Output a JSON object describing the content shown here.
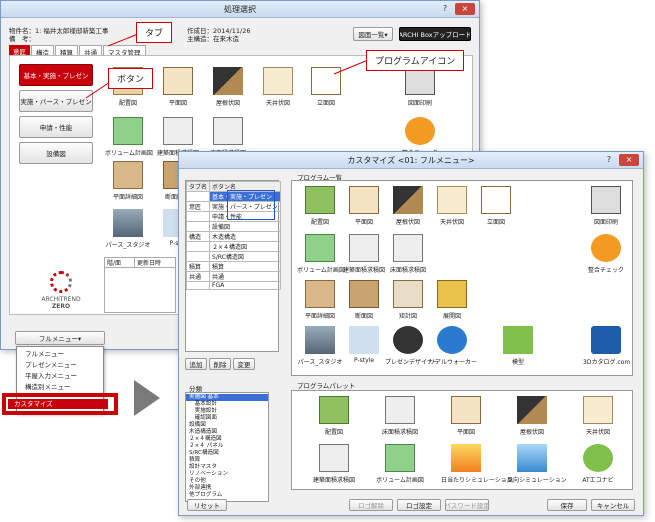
{
  "back_window": {
    "title": "処理選択",
    "help_btn": "?",
    "close_btn": "×",
    "property_name": "物件名：1: 福井太郎様邸新築工事",
    "property_note": "備　考：",
    "created_label": "作成日：2014/11/26",
    "structure_label": "主構造：在来木造",
    "list_button": "図面一覧▾",
    "upload_button": "ARCHI Boxアップロード",
    "tabs": [
      "意匠",
      "構造",
      "積算",
      "共通",
      "マスタ管理"
    ],
    "side_buttons": [
      "基本・実施・プレゼン",
      "実施・パース・プレゼン",
      "申請・性能",
      "設備図"
    ],
    "icons_row1": [
      "配置図",
      "平面図",
      "屋根伏図",
      "天井伏図",
      "立面図",
      "図面印刷"
    ],
    "icons_row2": [
      "ボリューム計画図",
      "建築面積求積図",
      "床面積求積図",
      "整合チェック"
    ],
    "icons_row3": [
      "平面詳細図",
      "断面図"
    ],
    "icons_row4": [
      "パース_スタジオ",
      "P-s"
    ],
    "table_headers": [
      "階/面",
      "更新日時"
    ],
    "logo_line1": "ARCHITREND",
    "logo_line2": "ZERO",
    "menu_button": "フルメニュー▾"
  },
  "dropdown": {
    "items": [
      "フルメニュー",
      "プレゼンメニュー",
      "平屋入力メニュー",
      "構造別メニュー"
    ],
    "selected": "カスタマイズ"
  },
  "callouts": {
    "tab": "タブ",
    "button": "ボタン",
    "program_icon": "プログラムアイコン"
  },
  "custom_window": {
    "title": "カスタマイズ <01: フルメニュー>",
    "help_btn": "?",
    "close_btn": "×",
    "table_headers": [
      "タブ名",
      "ボタン名"
    ],
    "table_rows": [
      [
        "",
        "基本・実施・プレゼン"
      ],
      [
        "意匠",
        "実施・パース・プレゼン"
      ],
      [
        "",
        "申請・性能"
      ],
      [
        "",
        "設備図"
      ],
      [
        "構造",
        "木造構造"
      ],
      [
        "",
        "２×４構造図"
      ],
      [
        "",
        "S/RC構造図"
      ],
      [
        "積算",
        "積算"
      ],
      [
        "共通",
        "共通"
      ],
      [
        "",
        "FGA"
      ]
    ],
    "table_buttons": [
      "追加",
      "削除",
      "変更"
    ],
    "category_label": "分類",
    "categories": [
      "実施図 基本",
      "　基本設計",
      "　実施設計",
      "　確認図面",
      "設備図",
      "木造構造図",
      "２×４構造図",
      "２×４ パネル",
      "S/RC構造図",
      "積算",
      "設計マスタ",
      "リノベーション",
      "その他",
      "外部連携",
      "他プログラム"
    ],
    "program_list_label": "プログラム一覧",
    "program_icons": [
      "配置図",
      "平面図",
      "屋根伏図",
      "天井伏図",
      "立面図",
      "図面印刷",
      "ボリューム計画図",
      "建築面積求積図",
      "床面積求積図",
      "整合チェック",
      "平面詳細図",
      "断面図",
      "矩計図",
      "展開図",
      "パース_スタジオ",
      "P-style",
      "プレゼンデザイナー",
      "リアルウォーカー",
      "模型",
      "3Dカタログ.com"
    ],
    "palette_label": "プログラムパレット",
    "palette_icons": [
      "配置図",
      "床面積求積図",
      "平面図",
      "屋根伏図",
      "天井伏図",
      "建築面積求積図",
      "ボリューム計画図",
      "日当たりシミュレーション",
      "風向シミュレーション",
      "ATエコナビ"
    ],
    "footer_buttons": {
      "reset": "リセット",
      "cancel_set": "ロゴ解除",
      "set": "ロゴ設定",
      "other": "パスワード設定",
      "save": "保存",
      "cancel": "キャンセル"
    }
  },
  "colors": {
    "red": "#c8000c",
    "selected_blue": "#2255cc"
  }
}
